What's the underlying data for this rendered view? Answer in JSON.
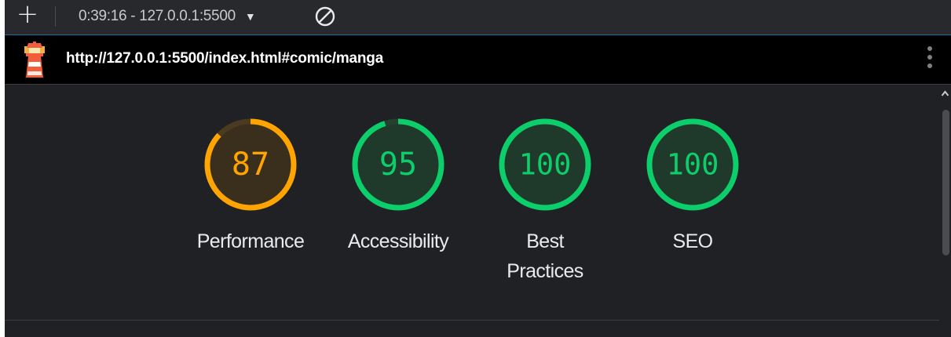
{
  "toolbar": {
    "add_label": "+",
    "report_label": "0:39:16 - 127.0.0.1:5500",
    "dropdown_caret": "▼"
  },
  "urlbar": {
    "url": "http://127.0.0.1:5500/index.html#comic/manga",
    "icon": "lighthouse-icon",
    "menu_icon": "kebab-menu-icon"
  },
  "scores": [
    {
      "id": "performance",
      "label_lines": [
        "Performance"
      ],
      "score": 87,
      "status": "average"
    },
    {
      "id": "accessibility",
      "label_lines": [
        "Accessibility"
      ],
      "score": 95,
      "status": "pass"
    },
    {
      "id": "best-practices",
      "label_lines": [
        "Best",
        "Practices"
      ],
      "score": 100,
      "status": "pass"
    },
    {
      "id": "seo",
      "label_lines": [
        "SEO"
      ],
      "score": 100,
      "status": "pass"
    }
  ],
  "colors": {
    "average": "#ffa400",
    "pass": "#0cce6b",
    "average_fill": "#3a2f1d",
    "pass_fill": "#1f3a2a",
    "track_average": "#4a3a1f",
    "track_pass": "#22412e"
  }
}
